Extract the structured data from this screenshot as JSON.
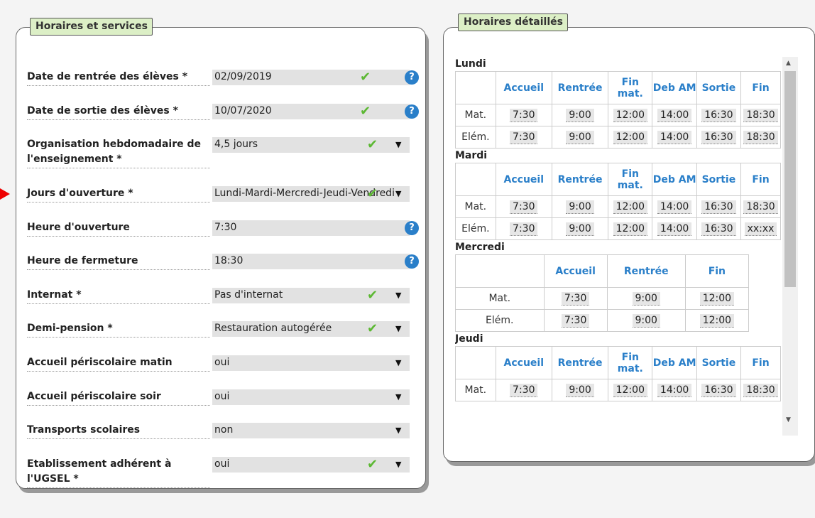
{
  "left_panel": {
    "title": "Horaires et services",
    "rows": [
      {
        "label": "Date de rentrée des élèves *",
        "value": "02/09/2019",
        "check": true,
        "dropdown": false,
        "help": true
      },
      {
        "label": "Date de sortie des élèves *",
        "value": "10/07/2020",
        "check": true,
        "dropdown": false,
        "help": true
      },
      {
        "label": "Organisation hebdomadaire de l'enseignement *",
        "value": "4,5 jours",
        "check": true,
        "dropdown": true,
        "help": false
      },
      {
        "label": "Jours d'ouverture *",
        "value": "Lundi-Mardi-Mercredi-Jeudi-Vendredi",
        "check": true,
        "dropdown": true,
        "help": false
      },
      {
        "label": "Heure d'ouverture",
        "value": "7:30",
        "check": false,
        "dropdown": false,
        "help": true
      },
      {
        "label": "Heure de fermeture",
        "value": "18:30",
        "check": false,
        "dropdown": false,
        "help": true
      },
      {
        "label": "Internat *",
        "value": "Pas d'internat",
        "check": true,
        "dropdown": true,
        "help": false
      },
      {
        "label": "Demi-pension *",
        "value": "Restauration autogérée",
        "check": true,
        "dropdown": true,
        "help": false
      },
      {
        "label": "Accueil périscolaire matin",
        "value": "oui",
        "check": false,
        "dropdown": true,
        "help": false
      },
      {
        "label": "Accueil périscolaire soir",
        "value": "oui",
        "check": false,
        "dropdown": true,
        "help": false
      },
      {
        "label": "Transports scolaires",
        "value": "non",
        "check": false,
        "dropdown": true,
        "help": false
      },
      {
        "label": "Etablissement adhérent à l'UGSEL *",
        "value": "oui",
        "check": true,
        "dropdown": true,
        "help": false
      }
    ]
  },
  "right_panel": {
    "title": "Horaires détaillés",
    "days": [
      {
        "name": "Lundi",
        "headers": [
          "Accueil",
          "Rentrée",
          "Fin mat.",
          "Deb AM",
          "Sortie",
          "Fin"
        ],
        "rows": [
          {
            "label": "Mat.",
            "values": [
              "7:30",
              "9:00",
              "12:00",
              "14:00",
              "16:30",
              "18:30"
            ]
          },
          {
            "label": "Elém.",
            "values": [
              "7:30",
              "9:00",
              "12:00",
              "14:00",
              "16:30",
              "18:30"
            ]
          }
        ]
      },
      {
        "name": "Mardi",
        "headers": [
          "Accueil",
          "Rentrée",
          "Fin mat.",
          "Deb AM",
          "Sortie",
          "Fin"
        ],
        "rows": [
          {
            "label": "Mat.",
            "values": [
              "7:30",
              "9:00",
              "12:00",
              "14:00",
              "16:30",
              "18:30"
            ]
          },
          {
            "label": "Elém.",
            "values": [
              "7:30",
              "9:00",
              "12:00",
              "14:00",
              "16:30",
              "xx:xx"
            ]
          }
        ]
      },
      {
        "name": "Mercredi",
        "headers": [
          "Accueil",
          "Rentrée",
          "Fin"
        ],
        "rows": [
          {
            "label": "Mat.",
            "values": [
              "7:30",
              "9:00",
              "12:00"
            ]
          },
          {
            "label": "Elém.",
            "values": [
              "7:30",
              "9:00",
              "12:00"
            ]
          }
        ]
      },
      {
        "name": "Jeudi",
        "headers": [
          "Accueil",
          "Rentrée",
          "Fin mat.",
          "Deb AM",
          "Sortie",
          "Fin"
        ],
        "rows": [
          {
            "label": "Mat.",
            "values": [
              "7:30",
              "9:00",
              "12:00",
              "14:00",
              "16:30",
              "18:30"
            ]
          }
        ]
      }
    ]
  },
  "icons": {
    "check": "check-icon",
    "dropdown": "chevron-down-icon",
    "help": "help-icon",
    "pointer": "arrow-right-icon"
  },
  "colors": {
    "accent": "#2a7fc9",
    "check": "#5cb833",
    "title_bg": "#dcefc6",
    "field_bg": "#e2e2e2",
    "pointer": "#e00000"
  }
}
